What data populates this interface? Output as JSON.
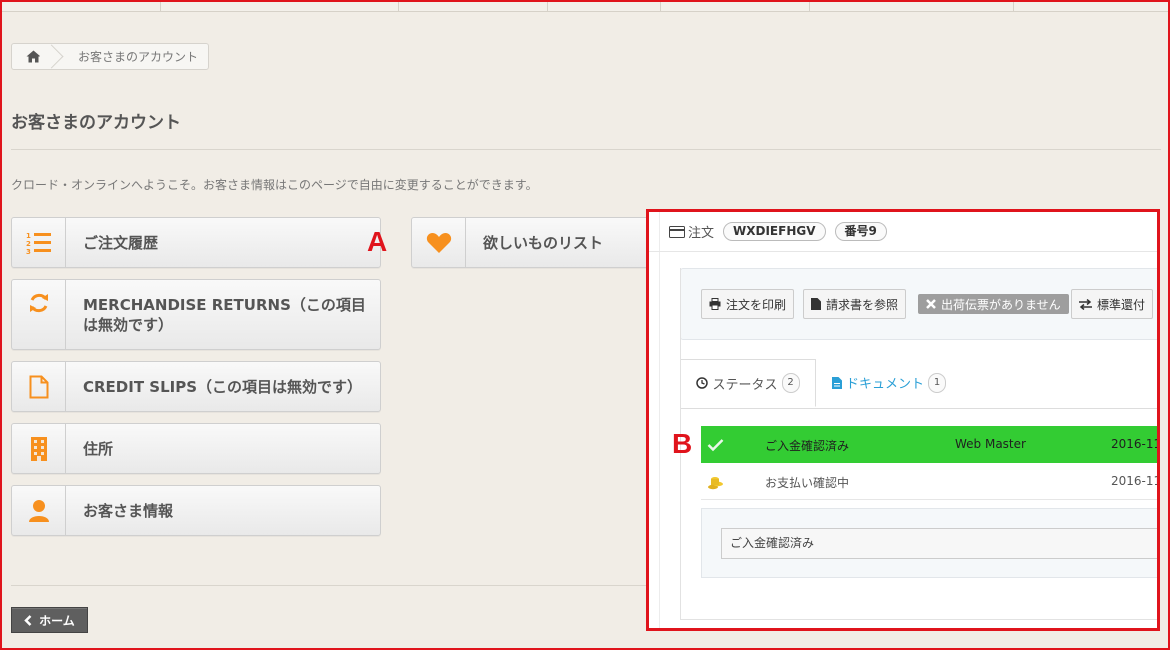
{
  "breadcrumb": {
    "home_icon": "home-icon",
    "current": "お客さまのアカウント"
  },
  "page": {
    "title": "お客さまのアカウント",
    "welcome": "クロード・オンラインへようこそ。お客さま情報はこのページで自由に変更することができます。"
  },
  "account_buttons": [
    {
      "label": "ご注文履歴",
      "icon": "list-ol-icon"
    },
    {
      "label": "MERCHANDISE RETURNS（この項目は無効です）",
      "icon": "refresh-icon"
    },
    {
      "label": "CREDIT SLIPS（この項目は無効です）",
      "icon": "file-icon"
    },
    {
      "label": "住所",
      "icon": "building-icon"
    },
    {
      "label": "お客さま情報",
      "icon": "user-icon"
    }
  ],
  "wishlist": {
    "label": "欲しいものリスト",
    "icon": "heart-icon"
  },
  "markers": {
    "a": "A",
    "b": "B"
  },
  "home_button": {
    "label": "ホーム"
  },
  "order_panel": {
    "label": "注文",
    "reference": "WXDIEFHGV",
    "number": "番号9",
    "actions": {
      "print": "注文を印刷",
      "invoice": "請求書を参照",
      "no_delivery": "出荷伝票がありません",
      "refund": "標準還付"
    },
    "tabs": {
      "status": {
        "label": "ステータス",
        "count": "2"
      },
      "documents": {
        "label": "ドキュメント",
        "count": "1"
      }
    },
    "status_rows": [
      {
        "status": "ご入金確認済み",
        "employee": "Web Master",
        "date": "2016-11"
      },
      {
        "status": "お支払い確認中",
        "employee": "",
        "date": "2016-11"
      }
    ],
    "status_select": "ご入金確認済み"
  },
  "colors": {
    "accent_orange": "#f7901e",
    "status_green": "#33cc33",
    "marker_red": "#e0141c",
    "link_blue": "#2a9fd6"
  }
}
